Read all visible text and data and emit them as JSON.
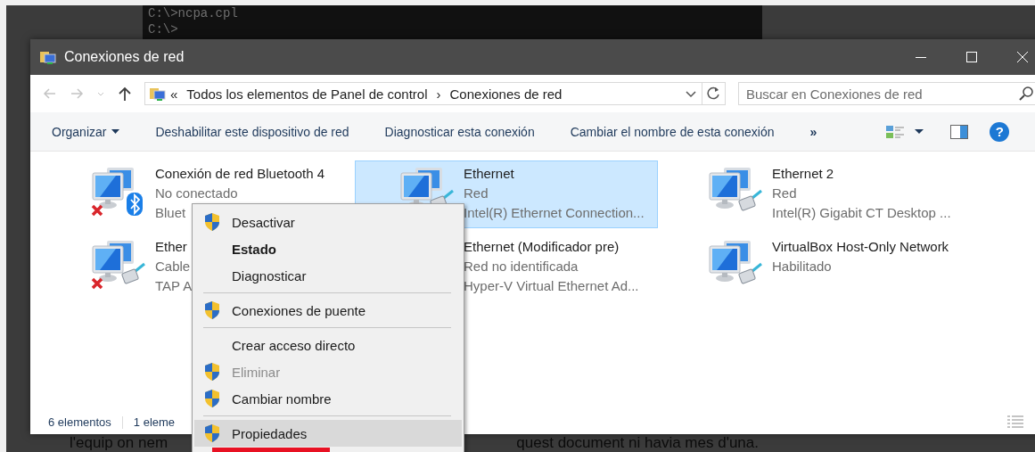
{
  "terminal": {
    "lines": [
      "C:\\>ncpa.cpl",
      "C:\\>"
    ]
  },
  "window": {
    "title": "Conexiones de red"
  },
  "navigation": {
    "back": {
      "disabled": true
    },
    "forward": {
      "disabled": true
    },
    "up": {
      "disabled": false
    }
  },
  "address": {
    "overflow": "«",
    "separator": "›",
    "path": [
      "Todos los elementos de Panel de control",
      "Conexiones de red"
    ]
  },
  "search": {
    "placeholder": "Buscar en Conexiones de red"
  },
  "toolbar": {
    "commands": [
      {
        "label": "Organizar",
        "kind": "menu"
      },
      {
        "label": "Deshabilitar este dispositivo de red",
        "kind": "command"
      },
      {
        "label": "Diagnosticar esta conexión",
        "kind": "command"
      },
      {
        "label": "Cambiar el nombre de esta conexión",
        "kind": "command"
      },
      {
        "label": "»",
        "kind": "more"
      }
    ],
    "help": "?"
  },
  "connections": [
    {
      "name": "Conexión de red Bluetooth 4",
      "status": "No conectado",
      "device": "Bluet",
      "kind": "bluetooth",
      "disconnected": true,
      "selected": false
    },
    {
      "name": "Ethernet",
      "status": "Red",
      "device": "Intel(R) Ethernet Connection...",
      "kind": "cable",
      "disconnected": false,
      "selected": true
    },
    {
      "name": "Ethernet 2",
      "status": "Red",
      "device": "Intel(R) Gigabit CT Desktop ...",
      "kind": "cable",
      "disconnected": false,
      "selected": false
    },
    {
      "name": "Ether",
      "status": "Cable",
      "device": "TAP A",
      "kind": "cable",
      "disconnected": true,
      "selected": false
    },
    {
      "name": "Ethernet (Modificador pre)",
      "status": "Red no identificada",
      "device": "Hyper-V Virtual Ethernet Ad...",
      "selected": false
    },
    {
      "name": "VirtualBox Host-Only Network",
      "status": "Habilitado",
      "kind": "cable",
      "disconnected": false,
      "selected": false
    }
  ],
  "status_bar": {
    "count": "6 elementos",
    "selection": "1 eleme"
  },
  "context_menu": [
    {
      "kind": "item",
      "label": "Desactivar",
      "shield": true,
      "default": false,
      "disabled": false,
      "selected": false
    },
    {
      "kind": "item",
      "label": "Estado",
      "shield": false,
      "default": true,
      "disabled": false,
      "selected": false
    },
    {
      "kind": "item",
      "label": "Diagnosticar",
      "shield": false,
      "default": false,
      "disabled": false,
      "selected": false
    },
    {
      "kind": "separator"
    },
    {
      "kind": "item",
      "label": "Conexiones de puente",
      "shield": true,
      "default": false,
      "disabled": false,
      "selected": false
    },
    {
      "kind": "separator"
    },
    {
      "kind": "item",
      "label": "Crear acceso directo",
      "shield": false,
      "default": false,
      "disabled": false,
      "selected": false
    },
    {
      "kind": "item",
      "label": "Eliminar",
      "shield": true,
      "default": false,
      "disabled": true,
      "selected": false
    },
    {
      "kind": "item",
      "label": "Cambiar nombre",
      "shield": true,
      "default": false,
      "disabled": false,
      "selected": false
    },
    {
      "kind": "separator"
    },
    {
      "kind": "item",
      "label": "Propiedades",
      "shield": true,
      "default": false,
      "disabled": false,
      "selected": true
    }
  ],
  "background_text": [
    "l'equip on nem",
    "quest document ni havia mes d'una."
  ]
}
